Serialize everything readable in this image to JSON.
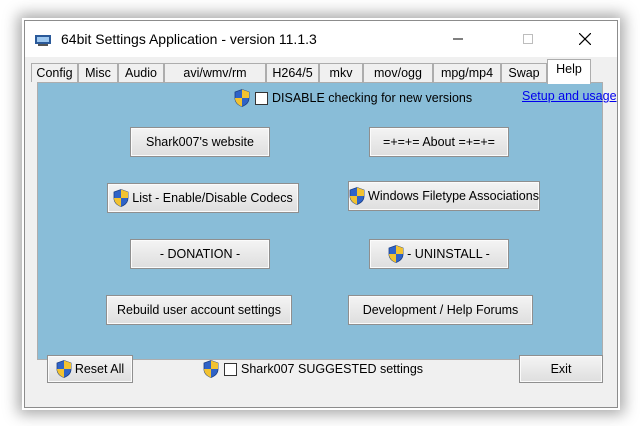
{
  "window": {
    "title": "64bit Settings Application - version 11.1.3",
    "icon": "app-icon",
    "controls": {
      "minimize": "minimize-icon",
      "maximize": "maximize-icon",
      "close": "close-icon"
    }
  },
  "tabs": [
    {
      "label": "Config"
    },
    {
      "label": "Misc"
    },
    {
      "label": "Audio"
    },
    {
      "label": "avi/wmv/rm"
    },
    {
      "label": "H264/5"
    },
    {
      "label": "mkv"
    },
    {
      "label": "mov/ogg"
    },
    {
      "label": "mpg/mp4"
    },
    {
      "label": "Swap"
    },
    {
      "label": "Help",
      "selected": true
    }
  ],
  "help": {
    "disable_check_label": "DISABLE checking for new versions",
    "disable_check_checked": false,
    "setup_link": "Setup and usage",
    "buttons": {
      "website": "Shark007's website",
      "about": "=+=+= About =+=+=",
      "codecs": "List - Enable/Disable Codecs",
      "filetypes": "Windows Filetype Associations",
      "donation": "- DONATION -",
      "uninstall": "- UNINSTALL -",
      "rebuild": "Rebuild user account settings",
      "forums": "Development / Help Forums"
    }
  },
  "footer": {
    "reset": "Reset All",
    "suggested_label": "Shark007 SUGGESTED settings",
    "suggested_checked": false,
    "exit": "Exit"
  },
  "colors": {
    "panel": "#89bdd8",
    "link": "#0000ee",
    "shield_blue": "#2f63c7",
    "shield_gold": "#f2c230"
  }
}
